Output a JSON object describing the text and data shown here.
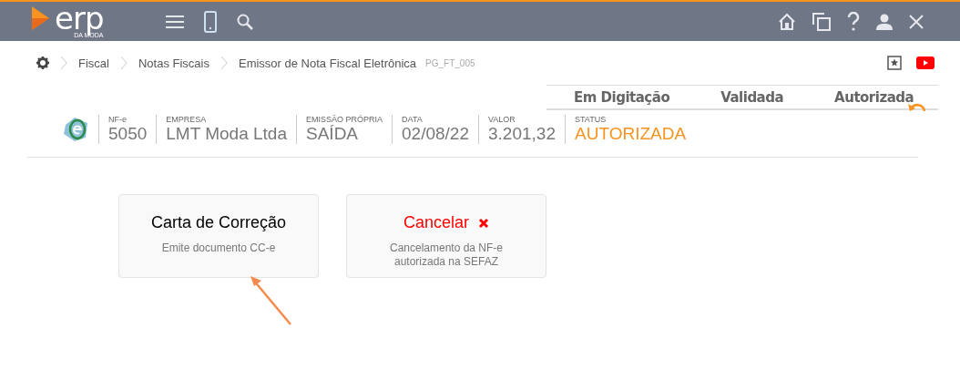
{
  "top_bar": {
    "logo_text": "erp",
    "logo_subtext": "DA MODA"
  },
  "breadcrumb": {
    "items": [
      "Fiscal",
      "Notas Fiscais",
      "Emissor de Nota Fiscal Eletrônica"
    ],
    "code": "PG_FT_005"
  },
  "stages": [
    "Em Digitação",
    "Validada",
    "Autorizada"
  ],
  "document": {
    "fields": [
      {
        "label": "NF-e",
        "value": "5050",
        "kind": "normal"
      },
      {
        "label": "EMPRESA",
        "value": "LMT Moda Ltda",
        "kind": "normal"
      },
      {
        "label": "EMISSÃO PRÓPRIA",
        "value": "SAÍDA",
        "kind": "normal"
      },
      {
        "label": "DATA",
        "value": "02/08/22",
        "kind": "normal"
      },
      {
        "label": "VALOR",
        "value": "3.201,32",
        "kind": "normal"
      },
      {
        "label": "STATUS",
        "value": "AUTORIZADA",
        "kind": "status"
      }
    ]
  },
  "actions": [
    {
      "title": "Carta de Correção",
      "description": "Emite documento CC-e",
      "kind": "correction"
    },
    {
      "title": "Cancelar",
      "description": "Cancelamento da NF-e autorizada na SEFAZ",
      "kind": "cancel"
    }
  ]
}
